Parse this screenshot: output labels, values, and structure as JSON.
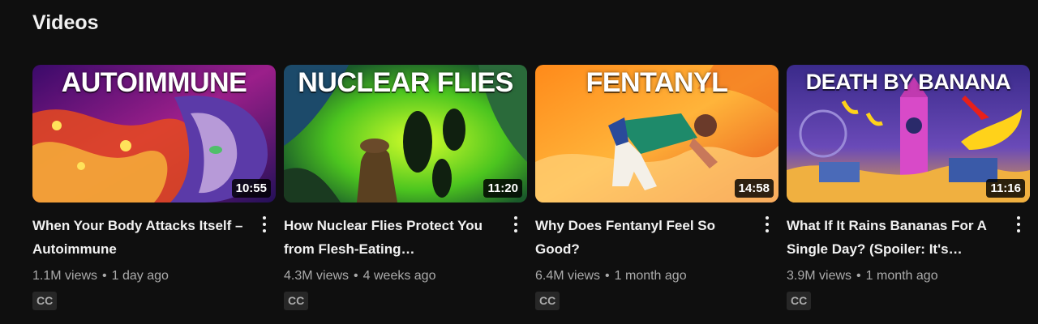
{
  "section": {
    "title": "Videos"
  },
  "videos": [
    {
      "thumb_text": "AUTOIMMUNE",
      "duration": "10:55",
      "title": "When Your Body Attacks Itself – Autoimmune",
      "views": "1.1M views",
      "age": "1 day ago",
      "badge": "CC"
    },
    {
      "thumb_text": "NUCLEAR FLIES",
      "duration": "11:20",
      "title": "How Nuclear Flies Protect You from Flesh-Eating…",
      "views": "4.3M views",
      "age": "4 weeks ago",
      "badge": "CC"
    },
    {
      "thumb_text": "FENTANYL",
      "duration": "14:58",
      "title": "Why Does Fentanyl Feel So Good?",
      "views": "6.4M views",
      "age": "1 month ago",
      "badge": "CC"
    },
    {
      "thumb_text": "DEATH BY BANANA",
      "duration": "11:16",
      "title": "What If It Rains Bananas For A Single Day? (Spoiler: It's…",
      "views": "3.9M views",
      "age": "1 month ago",
      "badge": "CC"
    }
  ],
  "separator": "•",
  "icons": {
    "more": "vertical-ellipsis-icon"
  },
  "colors": {
    "background": "#0f0f0f",
    "text": "#f1f1f1",
    "secondary_text": "#aaaaaa",
    "badge_bg": "#272727"
  }
}
